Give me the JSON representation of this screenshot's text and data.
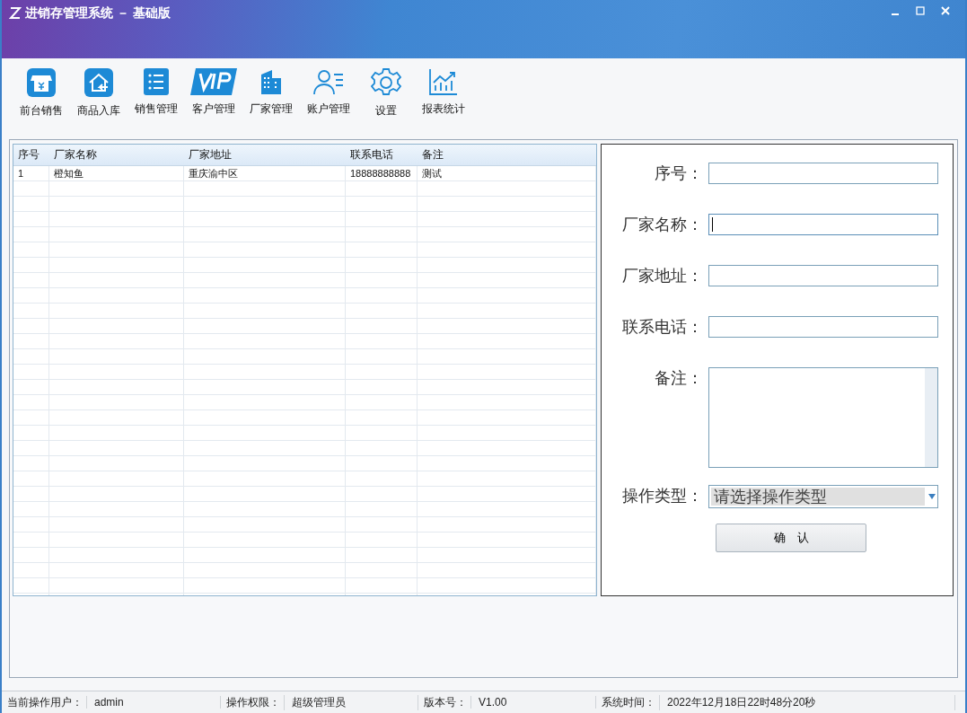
{
  "window": {
    "title": "进销存管理系统 － 基础版"
  },
  "toolbar": [
    {
      "label": "前台销售"
    },
    {
      "label": "商品入库"
    },
    {
      "label": "销售管理"
    },
    {
      "label": "客户管理"
    },
    {
      "label": "厂家管理"
    },
    {
      "label": "账户管理"
    },
    {
      "label": "设置"
    },
    {
      "label": "报表统计"
    }
  ],
  "table": {
    "columns": [
      "序号",
      "厂家名称",
      "厂家地址",
      "联系电话",
      "备注"
    ],
    "rows": [
      [
        "1",
        "橙知鱼",
        "重庆渝中区",
        "18888888888",
        "测试"
      ]
    ]
  },
  "form": {
    "fields": [
      {
        "kind": "input",
        "label": "序号：",
        "focused": false
      },
      {
        "kind": "input",
        "label": "厂家名称：",
        "focused": true
      },
      {
        "kind": "input",
        "label": "厂家地址：",
        "focused": false
      },
      {
        "kind": "input",
        "label": "联系电话：",
        "focused": false
      },
      {
        "kind": "textarea",
        "label": "备注："
      },
      {
        "kind": "select",
        "label": "操作类型：",
        "value": "请选择操作类型"
      }
    ],
    "button": "确　认"
  },
  "status_bar": [
    {
      "label": "当前操作用户：",
      "value": "admin"
    },
    {
      "label": "操作权限：",
      "value": "超级管理员"
    },
    {
      "label": "版本号：",
      "value": "V1.00"
    },
    {
      "label": "系统时间：",
      "value": "2022年12月18日22时48分20秒"
    }
  ]
}
